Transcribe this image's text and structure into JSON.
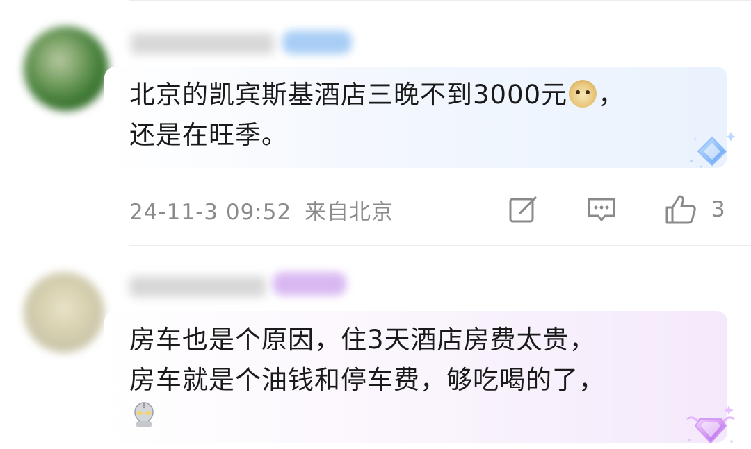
{
  "comments": [
    {
      "text_line1_prefix": "北京的凯宾斯基酒店三晚不到3000元",
      "text_line1_suffix": "，",
      "text_line2": "还是在旺季。",
      "emoji": "doge-emoji",
      "timestamp": "24-11-3 09:52",
      "location": "来自北京",
      "like_count": "3",
      "actions": [
        "edit-icon",
        "comment-icon",
        "thumbs-up-icon"
      ]
    },
    {
      "text_line1": "房车也是个原因，住3天酒店房费太贵，",
      "text_line2": "房车就是个油钱和停车费，够吃喝的了，",
      "emoji": "ultraman-emoji"
    }
  ],
  "colors": {
    "text": "#1a1a1a",
    "meta": "#8a8a8a",
    "badge_blue": "#a8cef5",
    "badge_purple": "#d9b8f2"
  }
}
